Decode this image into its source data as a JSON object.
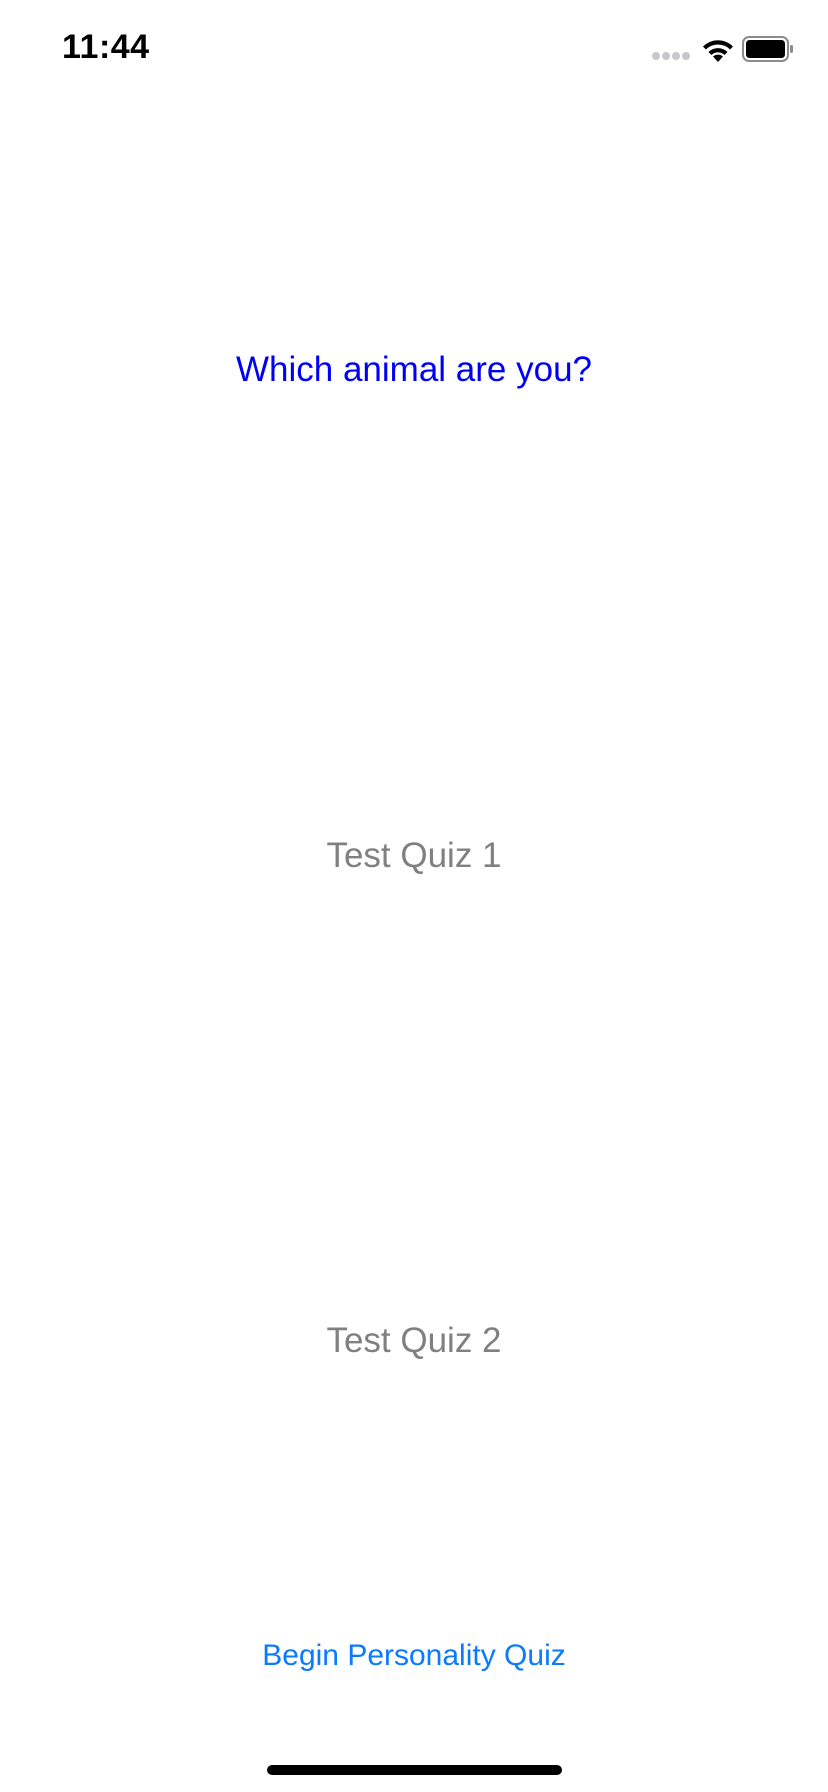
{
  "status_bar": {
    "time": "11:44",
    "cell_icon": "cellular-signal-icon",
    "wifi_icon": "wifi-icon",
    "battery_icon": "battery-icon"
  },
  "quiz": {
    "title": "Which animal are you?",
    "options": [
      {
        "label": "Test Quiz 1"
      },
      {
        "label": "Test Quiz 2"
      }
    ],
    "begin_label": "Begin Personality Quiz"
  },
  "colors": {
    "title": "#0000f5",
    "option_text": "#808080",
    "button_tint": "#0a7aff",
    "background": "#ffffff"
  }
}
